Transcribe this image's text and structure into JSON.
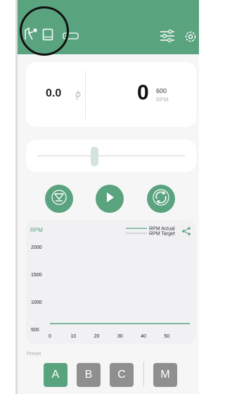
{
  "header": {
    "icons": [
      "route-icon",
      "tablet-icon",
      "battery-icon",
      "sliders-icon",
      "gear-icon"
    ]
  },
  "stats": {
    "time_value": "0.0",
    "time_unit": "s",
    "rpm_value": "0",
    "rpm_target": "600",
    "rpm_unit": "RPM"
  },
  "slider": {
    "level": 0.4
  },
  "controls": [
    "down-icon",
    "play-icon",
    "sync-icon"
  ],
  "chart_data": {
    "type": "line",
    "ylabel": "RPM",
    "x": [
      0,
      10,
      20,
      30,
      40,
      50
    ],
    "ylim": [
      500,
      2000
    ],
    "yticks": [
      500,
      1000,
      1500,
      2000
    ],
    "xticks": [
      0,
      10,
      20,
      30,
      40,
      50
    ],
    "series": [
      {
        "name": "RPM Actual",
        "color": "#5aa37f",
        "values": [
          600,
          600,
          600,
          600,
          600,
          600
        ]
      },
      {
        "name": "RPM Target",
        "color": "#c8c8c8",
        "values": [
          600,
          600,
          600,
          600,
          600,
          600
        ]
      }
    ],
    "legend": "top-right"
  },
  "preset": {
    "label": "Preset",
    "buttons": [
      {
        "label": "A",
        "active": true,
        "color": "#5aa37f"
      },
      {
        "label": "B",
        "active": false,
        "color": "#8f8f8f"
      },
      {
        "label": "C",
        "active": false,
        "color": "#8f8f8f"
      }
    ],
    "manual": {
      "label": "M",
      "color": "#8f8f8f"
    }
  }
}
